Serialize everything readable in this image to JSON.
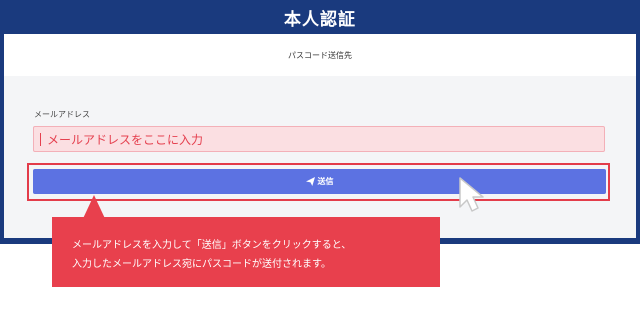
{
  "header": {
    "title": "本人認証"
  },
  "panel": {
    "heading": "パスコード送信先"
  },
  "form": {
    "email_label": "メールアドレス",
    "email_placeholder": "メールアドレスをここに入力",
    "send_label": "送信"
  },
  "tooltip": {
    "lines": [
      "メールアドレスを入力して「送信」ボタンをクリックすると、",
      "入力したメールアドレス宛にパスコードが送付されます。"
    ]
  },
  "colors": {
    "title_bar": "#1a3a7e",
    "send_button": "#5c72e2",
    "input_background": "#fbdfe2",
    "highlight": "#e33c4a",
    "tooltip": "#e8404d"
  },
  "icons": {
    "send": "paper-plane-icon",
    "pointer": "mouse-pointer-icon"
  }
}
